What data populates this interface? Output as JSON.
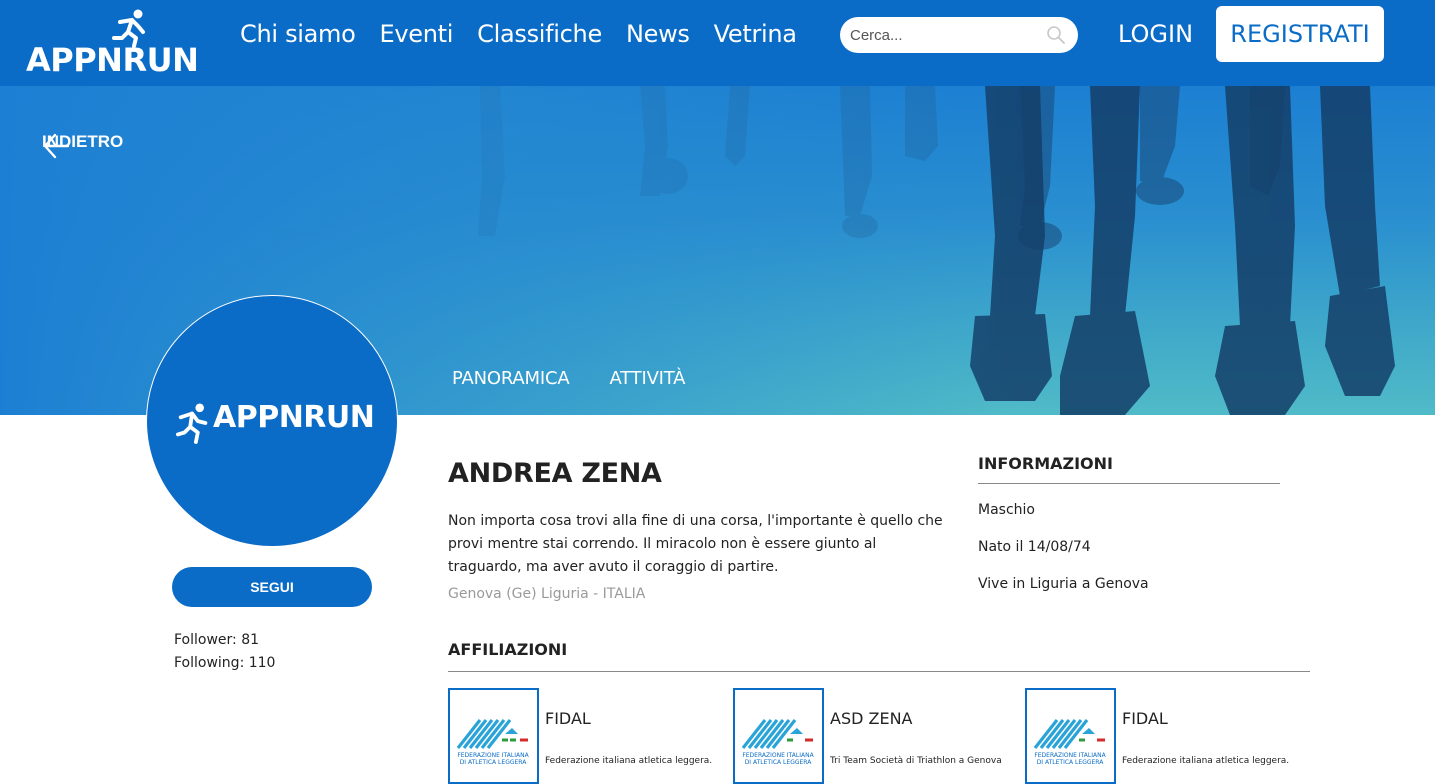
{
  "header": {
    "logo_text": "APPNRUN",
    "nav": [
      "Chi siamo",
      "Eventi",
      "Classifiche",
      "News",
      "Vetrina"
    ],
    "search_placeholder": "Cerca...",
    "login_label": "LOGIN",
    "register_label": "REGISTRATI"
  },
  "hero": {
    "back_label": "INDIETRO",
    "tabs": [
      "PANORAMICA",
      "ATTIVITÀ"
    ]
  },
  "profile": {
    "avatar_text": "APPNRUN",
    "follow_label": "SEGUI",
    "followers": "Follower: 81",
    "following": "Following: 110",
    "name": "ANDREA ZENA",
    "bio": "Non importa cosa trovi alla fine di una corsa, l'importante è quello che provi mentre stai correndo. Il miracolo non è essere giunto al traguardo, ma aver avuto il coraggio di partire.",
    "location": "Genova (Ge) Liguria - ITALIA"
  },
  "info": {
    "title": "INFORMAZIONI",
    "gender": "Maschio",
    "birth": "Nato il 14/08/74",
    "residence": "Vive in Liguria a Genova"
  },
  "affiliations": {
    "title": "AFFILIAZIONI",
    "logo_caption_1": "FEDERAZIONE ITALIANA",
    "logo_caption_2": "DI ATLETICA LEGGERA",
    "items": [
      {
        "name": "FIDAL",
        "desc": "Federazione italiana atletica leggera."
      },
      {
        "name": "ASD ZENA",
        "desc": "Tri Team Società di Triathlon a Genova"
      },
      {
        "name": "FIDAL",
        "desc": "Federazione italiana atletica leggera."
      }
    ]
  },
  "colors": {
    "brand_blue": "#0a6cc6",
    "hero_teal": "#45b6c6",
    "muted_text": "#9a9a9a"
  }
}
